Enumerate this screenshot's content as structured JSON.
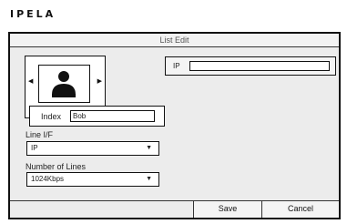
{
  "brand": {
    "logo": "IPELA"
  },
  "window": {
    "title": "List Edit"
  },
  "photo": {
    "icon": "person-silhouette-icon",
    "prev_icon": "triangle-left-icon",
    "next_icon": "triangle-right-icon"
  },
  "index": {
    "label": "Index",
    "value": "Bob"
  },
  "line_if": {
    "label": "Line I/F",
    "selected": "IP"
  },
  "number_of_lines": {
    "label": "Number of Lines",
    "selected": "1024Kbps"
  },
  "ip": {
    "label": "IP",
    "value": ""
  },
  "buttons": {
    "save": "Save",
    "cancel": "Cancel"
  }
}
